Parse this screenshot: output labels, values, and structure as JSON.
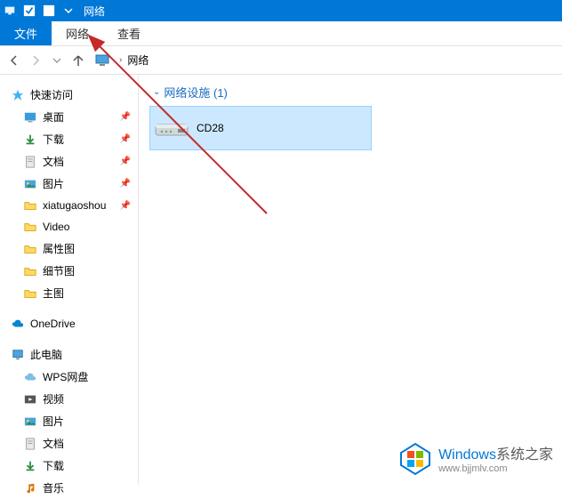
{
  "titlebar": {
    "title": "网络"
  },
  "tabs": {
    "file": "文件",
    "network": "网络",
    "view": "查看"
  },
  "breadcrumb": {
    "location": "网络"
  },
  "navpane": {
    "quick_access": "快速访问",
    "items_pinned": [
      {
        "label": "桌面",
        "icon": "desktop"
      },
      {
        "label": "下载",
        "icon": "download"
      },
      {
        "label": "文档",
        "icon": "document"
      },
      {
        "label": "图片",
        "icon": "picture"
      },
      {
        "label": "xiatugaoshou",
        "icon": "folder"
      }
    ],
    "items_unpinned": [
      {
        "label": "Video",
        "icon": "folder"
      },
      {
        "label": "属性图",
        "icon": "folder"
      },
      {
        "label": "细节图",
        "icon": "folder"
      },
      {
        "label": "主图",
        "icon": "folder"
      }
    ],
    "onedrive": "OneDrive",
    "thispc": "此电脑",
    "thispc_items": [
      {
        "label": "WPS网盘",
        "icon": "cloud"
      },
      {
        "label": "视频",
        "icon": "video"
      },
      {
        "label": "图片",
        "icon": "picture"
      },
      {
        "label": "文档",
        "icon": "document"
      },
      {
        "label": "下载",
        "icon": "download"
      },
      {
        "label": "音乐",
        "icon": "music"
      }
    ]
  },
  "content": {
    "group_header": "网络设施 (1)",
    "device_name": "CD28"
  },
  "watermark": {
    "brand_a": "Windows",
    "brand_b": "系统之家",
    "url": "www.bjjmlv.com"
  }
}
